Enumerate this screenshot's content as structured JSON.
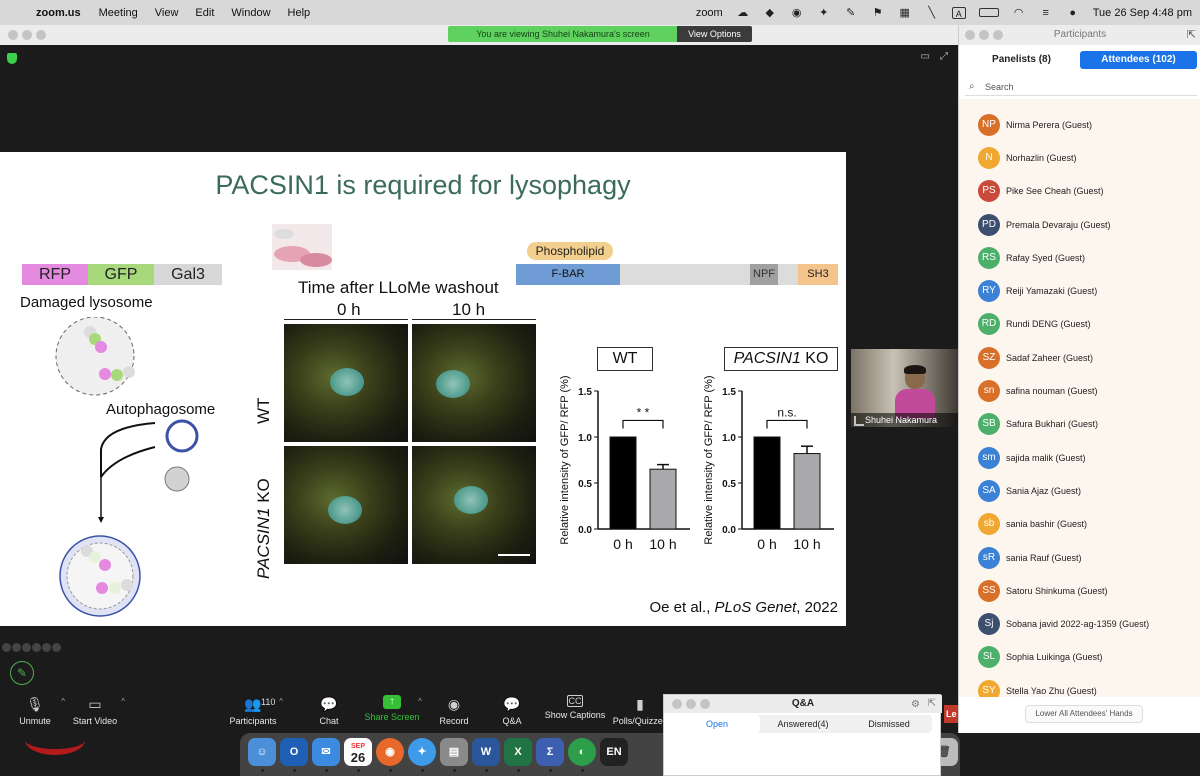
{
  "menubar": {
    "app": "zoom.us",
    "items": [
      "Meeting",
      "View",
      "Edit",
      "Window",
      "Help"
    ],
    "clock": "Tue 26 Sep  4:48 pm",
    "zoom_label": "zoom",
    "input_label": "A"
  },
  "banner": {
    "viewing": "You are viewing Shuhei Nakamura's screen",
    "view_options": "View Options"
  },
  "slide": {
    "title": "PACSIN1 is required for lysophagy",
    "probe_labels": [
      "RFP",
      "GFP",
      "Gal3"
    ],
    "damaged": "Damaged lysosome",
    "autophagosome": "Autophagosome",
    "time_after": "Time after LLoMe washout",
    "time_0": "0 h",
    "time_10": "10 h",
    "row_wt": "WT",
    "row_ko_gene": "PACSIN1",
    "row_ko_suffix": " KO",
    "phospholipid": "Phospholipid",
    "fbar": "F-BAR",
    "npf": "NPF",
    "sh3": "SH3",
    "chart1_label": "WT",
    "chart2_label_gene": "PACSIN1",
    "chart2_label_suffix": " KO",
    "citation_pre": "Oe et al., ",
    "citation_journal": "PLoS Genet",
    "citation_post": ", 2022"
  },
  "chart_data": [
    {
      "type": "bar",
      "title": "WT",
      "ylabel": "Relative intensity of GFP/ RFP (%)",
      "categories": [
        "0 h",
        "10 h"
      ],
      "values": [
        1.0,
        0.65
      ],
      "errors": [
        0,
        0.05
      ],
      "ylim": [
        0.0,
        1.5
      ],
      "yticks": [
        "0.0",
        "0.5",
        "1.0",
        "1.5"
      ],
      "annotation": "* *"
    },
    {
      "type": "bar",
      "title": "PACSIN1 KO",
      "ylabel": "Relative intensity of GFP/ RFP (%)",
      "categories": [
        "0 h",
        "10 h"
      ],
      "values": [
        1.0,
        0.82
      ],
      "errors": [
        0,
        0.08
      ],
      "ylim": [
        0.0,
        1.5
      ],
      "yticks": [
        "0.0",
        "0.5",
        "1.0",
        "1.5"
      ],
      "annotation": "n.s."
    }
  ],
  "video_tile": {
    "name": "Shuhei Nakamura"
  },
  "toolbar": {
    "unmute": "Unmute",
    "start_video": "Start Video",
    "participants": "Participants",
    "participants_count": "110",
    "chat": "Chat",
    "share_screen": "Share Screen",
    "record": "Record",
    "qa": "Q&A",
    "captions": "Show Captions",
    "polls": "Polls/Quizzes"
  },
  "qa": {
    "title": "Q&A",
    "tabs": [
      "Open",
      "Answered(4)",
      "Dismissed"
    ]
  },
  "leave_fragment": "Le",
  "participants_panel": {
    "title": "Participants",
    "tab_panelists": "Panelists (8)",
    "tab_attendees": "Attendees (102)",
    "search_placeholder": "Search",
    "lower_hands": "Lower All Attendees' Hands",
    "people": [
      {
        "initials": "NP",
        "name": "Nirma Perera (Guest)",
        "color": "#d9702a"
      },
      {
        "initials": "N",
        "name": "Norhazlin (Guest)",
        "color": "#f0a830"
      },
      {
        "initials": "PS",
        "name": "Pike See Cheah (Guest)",
        "color": "#c94a3a"
      },
      {
        "initials": "PD",
        "name": "Premala Devaraju (Guest)",
        "color": "#3c4f6e"
      },
      {
        "initials": "RS",
        "name": "Rafay Syed (Guest)",
        "color": "#4caf6a"
      },
      {
        "initials": "RY",
        "name": "Reiji Yamazaki (Guest)",
        "color": "#3b82d6"
      },
      {
        "initials": "RD",
        "name": "Rundi DENG (Guest)",
        "color": "#4caf6a"
      },
      {
        "initials": "SZ",
        "name": "Sadaf Zaheer (Guest)",
        "color": "#d9702a"
      },
      {
        "initials": "sn",
        "name": "safina nouman (Guest)",
        "color": "#d9702a"
      },
      {
        "initials": "SB",
        "name": "Safura Bukhari (Guest)",
        "color": "#4caf6a"
      },
      {
        "initials": "sm",
        "name": "sajida malik (Guest)",
        "color": "#3b82d6"
      },
      {
        "initials": "SA",
        "name": "Sania Ajaz (Guest)",
        "color": "#3b82d6"
      },
      {
        "initials": "sb",
        "name": "sania bashir (Guest)",
        "color": "#f0a830"
      },
      {
        "initials": "sR",
        "name": "sania Rauf (Guest)",
        "color": "#3b82d6"
      },
      {
        "initials": "SS",
        "name": "Satoru Shinkuma (Guest)",
        "color": "#d9702a"
      },
      {
        "initials": "Sj",
        "name": "Sobana javid 2022-ag-1359 (Guest)",
        "color": "#3c4f6e"
      },
      {
        "initials": "SL",
        "name": "Sophia Luikinga (Guest)",
        "color": "#4caf6a"
      },
      {
        "initials": "SY",
        "name": "Stella Yao Zhu (Guest)",
        "color": "#f0a830"
      }
    ]
  },
  "dock": {
    "calendar_month": "SEP",
    "calendar_day": "26",
    "en_label": "EN"
  }
}
